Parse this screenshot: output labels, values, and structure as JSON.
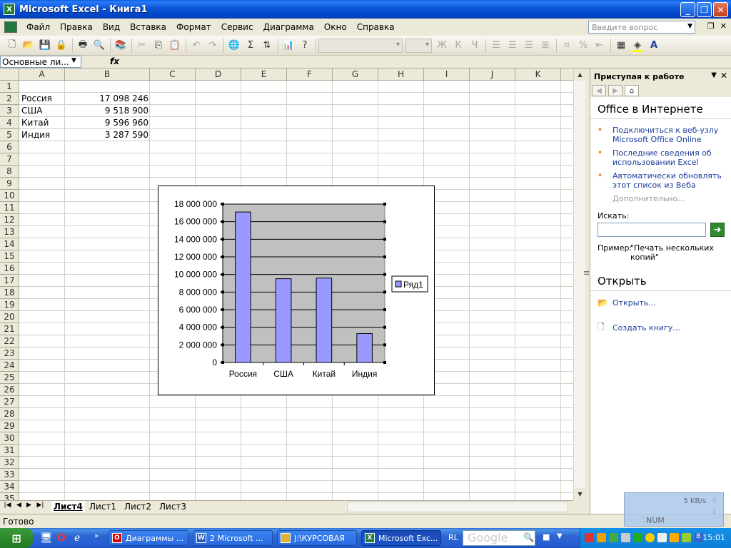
{
  "window": {
    "title": "Microsoft Excel - Книга1",
    "app_icon_letter": "X"
  },
  "menu": {
    "items": [
      "Файл",
      "Правка",
      "Вид",
      "Вставка",
      "Формат",
      "Сервис",
      "Диаграмма",
      "Окно",
      "Справка"
    ],
    "help_placeholder": "Введите вопрос"
  },
  "toolbar": {
    "icons": [
      "new-icon",
      "open-icon",
      "save-icon",
      "permission-icon",
      "print-icon",
      "print-preview-icon",
      "research-icon",
      "copy-icon",
      "paste-icon",
      "undo-icon",
      "hyperlink-icon",
      "autosum-icon",
      "sort-icon",
      "chart-wizard-icon",
      "help-icon"
    ],
    "bold": "Ж",
    "italic": "К",
    "underline": "Ч",
    "percent": "%",
    "font_color_letter": "A"
  },
  "formula_bar": {
    "name_box": "Основные ли...",
    "fx": "fx"
  },
  "grid": {
    "columns": [
      "A",
      "B",
      "C",
      "D",
      "E",
      "F",
      "G",
      "H",
      "I",
      "J",
      "K"
    ],
    "rows": [
      "1",
      "2",
      "3",
      "4",
      "5",
      "6",
      "7",
      "8",
      "9",
      "10",
      "11",
      "12",
      "13",
      "14",
      "15",
      "16",
      "17",
      "18",
      "19",
      "20",
      "21",
      "22",
      "23",
      "24",
      "25",
      "26",
      "27",
      "28",
      "29",
      "30",
      "31",
      "32",
      "33",
      "34",
      "35"
    ],
    "cells": [
      {
        "row": 2,
        "a": "Россия",
        "b": "17 098 246"
      },
      {
        "row": 3,
        "a": "США",
        "b": "9 518 900"
      },
      {
        "row": 4,
        "a": "Китай",
        "b": "9 596 960"
      },
      {
        "row": 5,
        "a": "Индия",
        "b": "3 287 590"
      }
    ]
  },
  "chart_data": {
    "type": "bar",
    "categories": [
      "Россия",
      "США",
      "Китай",
      "Индия"
    ],
    "series": [
      {
        "name": "Ряд1",
        "values": [
          17098246,
          9518900,
          9596960,
          3287590
        ],
        "color": "#9999ff"
      }
    ],
    "ylim": [
      0,
      18000000
    ],
    "yticks": [
      "0",
      "2 000 000",
      "4 000 000",
      "6 000 000",
      "8 000 000",
      "10 000 000",
      "12 000 000",
      "14 000 000",
      "16 000 000",
      "18 000 000"
    ],
    "plot_bg": "#c0c0c0",
    "grid": true,
    "legend": "right"
  },
  "sheets": {
    "tabs": [
      "Лист4",
      "Лист1",
      "Лист2",
      "Лист3"
    ],
    "active": "Лист4"
  },
  "status": {
    "text": "Готово",
    "num": "NUM",
    "net_speed": "5 KB/s"
  },
  "taskpane": {
    "title": "Приступая к работе",
    "section_online": "Office в Интернете",
    "links": [
      "Подключиться к веб-узлу Microsoft Office Online",
      "Последние сведения об использовании Excel",
      "Автоматически обновлять этот список из Веба"
    ],
    "more": "Дополнительно...",
    "search_label": "Искать:",
    "search_value": "",
    "example_label": "Пример:",
    "example_text": "\"Печать нескольких копий\"",
    "section_open": "Открыть",
    "open_link": "Открыть...",
    "create_link": "Создать книгу..."
  },
  "taskbar": {
    "start_icon": "windows-logo-icon",
    "tasks": [
      {
        "label": "Диаграммы ...",
        "icon": "opera-icon"
      },
      {
        "label": "2 Microsoft ...",
        "icon": "word-icon"
      },
      {
        "label": "J:\\КУРСОВАЯ",
        "icon": "folder-icon"
      },
      {
        "label": "Microsoft Exc...",
        "icon": "excel-icon"
      }
    ],
    "lang": "RL",
    "google_text": "Google",
    "clock": "15:01"
  }
}
